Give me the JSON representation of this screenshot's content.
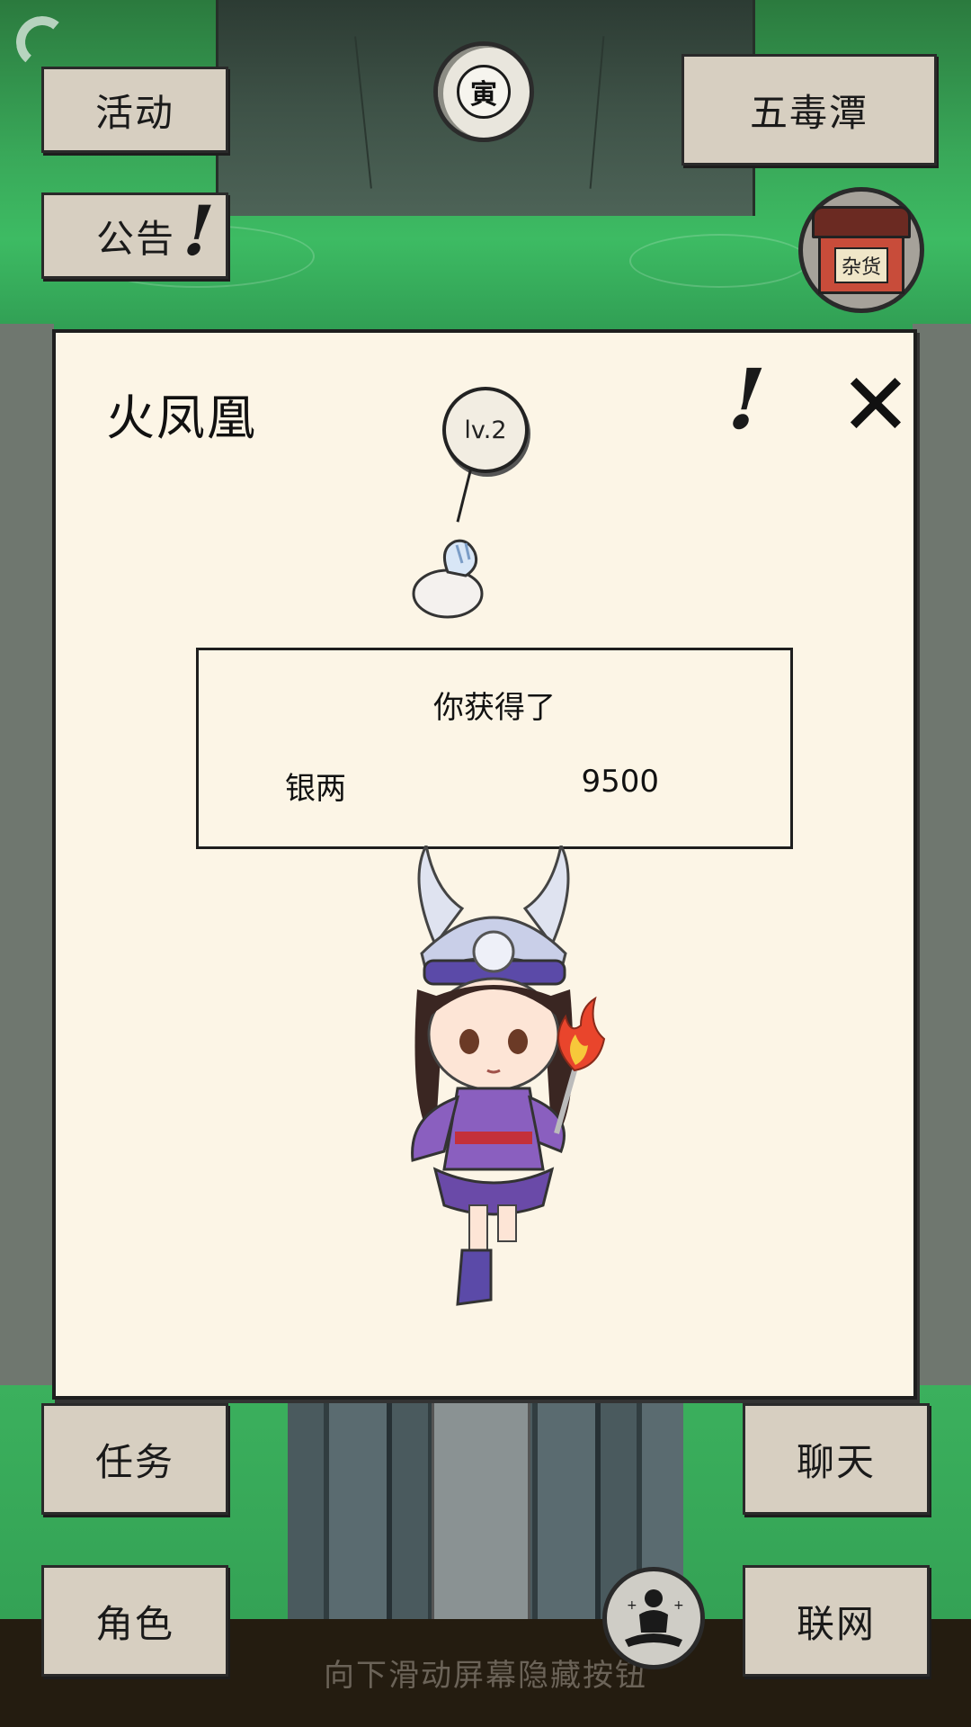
{
  "top_buttons": {
    "activity": "活动",
    "notice": "公告",
    "location": "五毒潭"
  },
  "moon_badge": {
    "glyph": "寅"
  },
  "shop_badge": {
    "sign": "杂货"
  },
  "card": {
    "title": "火凤凰",
    "level": "lv.2",
    "reward": {
      "heading": "你获得了",
      "item": "银两",
      "amount": "9500"
    }
  },
  "bottom_buttons": {
    "task": "任务",
    "chat": "聊天",
    "role": "角色",
    "network": "联网"
  },
  "hint": "向下滑动屏幕隐藏按钮",
  "icons": {
    "back": "back-arc-icon",
    "exclaim": "exclamation-icon",
    "close": "close-icon",
    "meditate": "meditate-icon",
    "shop": "shop-icon",
    "moon": "moon-icon",
    "coin_bag": "coin-bag-icon"
  },
  "colors": {
    "card_bg": "#fcf5e6",
    "button_bg": "#d7cfc1",
    "grass": "#3dbb63",
    "bottom_bar": "#241c10"
  }
}
